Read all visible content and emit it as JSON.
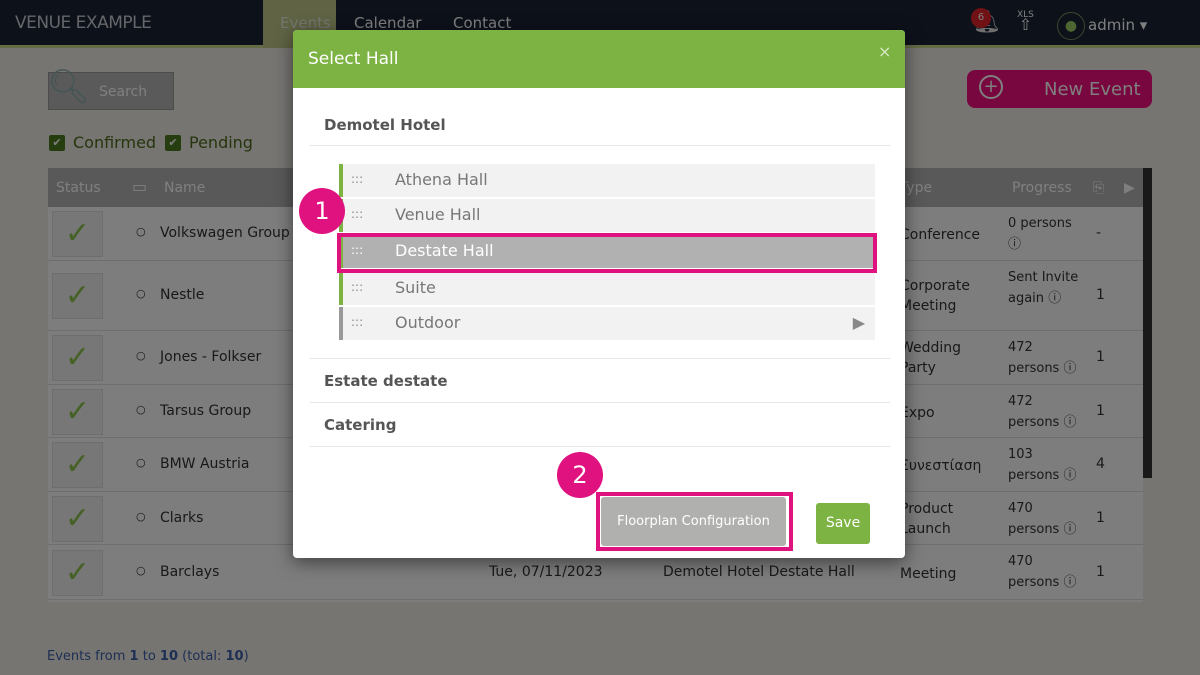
{
  "header": {
    "brand": "VENUE EXAMPLE",
    "nav": [
      "Events",
      "Calendar",
      "Contact"
    ],
    "notifications": "6",
    "xls": "XLS",
    "user": "admin"
  },
  "toolbar": {
    "search": "Search",
    "new_event": "New Event",
    "filters": [
      "Confirmed",
      "Pending"
    ]
  },
  "table": {
    "columns": [
      "Status",
      "Name",
      "Type",
      "Progress"
    ],
    "rows": [
      {
        "name": "Volkswagen Group",
        "type": "Conference",
        "progress": "0 persons",
        "count": "-"
      },
      {
        "name": "Nestle",
        "type": "Corporate Meeting",
        "progress": "Sent  Invite again",
        "count": "1"
      },
      {
        "name": "Jones - Folkser",
        "type": "Wedding Party",
        "progress": "472 persons",
        "count": "1"
      },
      {
        "name": "Tarsus Group",
        "type": "Expo",
        "progress": "472 persons",
        "count": "1"
      },
      {
        "name": "BMW Austria",
        "type": "Συνεστίαση",
        "progress": "103 persons",
        "count": "4"
      },
      {
        "name": "Clarks",
        "type": "Product Launch",
        "progress": "470 persons",
        "count": "1"
      },
      {
        "name": "Barclays",
        "date": "Tue, 07/11/2023",
        "venue": "Demotel Hotel  Destate Hall",
        "type": "Meeting",
        "progress": "470 persons",
        "count": "1"
      }
    ]
  },
  "footer": {
    "prefix": "Events from ",
    "from": "1",
    "to_label": " to ",
    "to": "10",
    "total_label": " (total: ",
    "total": "10",
    "suffix": ")"
  },
  "modal": {
    "title": "Select Hall",
    "close": "×",
    "groups": [
      {
        "name": "Demotel Hotel",
        "halls": [
          "Athena Hall",
          "Venue Hall",
          "Destate Hall",
          "Suite",
          "Outdoor"
        ],
        "selected": "Destate Hall"
      },
      {
        "name": "Estate destate"
      },
      {
        "name": "Catering"
      }
    ],
    "floorplan_button": "Floorplan Configuration",
    "save_button": "Save"
  },
  "annotations": [
    "1",
    "2"
  ],
  "colors": {
    "accent_green": "#7cb342",
    "highlight_pink": "#e0127f",
    "new_event": "#f00c7e"
  }
}
